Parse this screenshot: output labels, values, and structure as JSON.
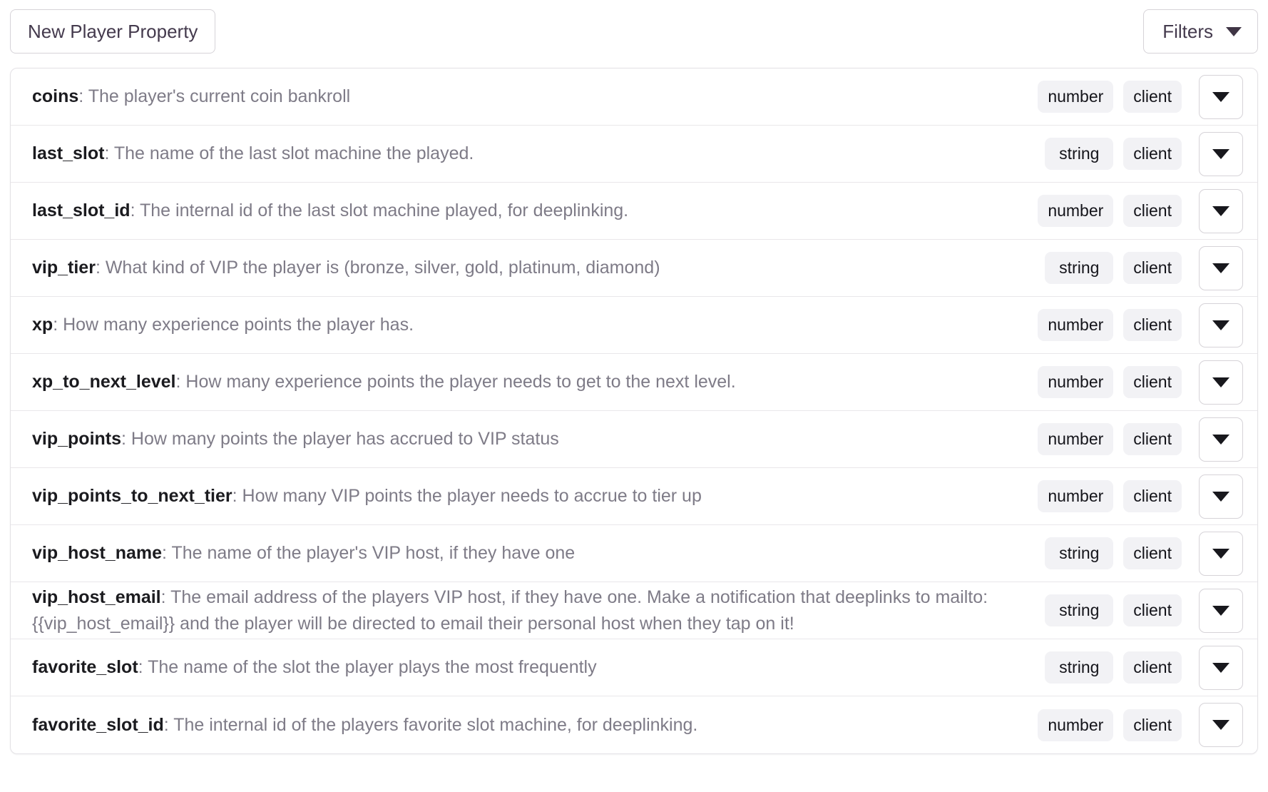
{
  "toolbar": {
    "new_property_label": "New Player Property",
    "filters_label": "Filters",
    "filters_caret_icon": "chevron-down-icon"
  },
  "colors": {
    "badge_background": "#f2f2f5",
    "badge_text": "#14141a",
    "description_text": "#7e7b87",
    "property_name_text": "#1b1b1f",
    "button_text": "#443a4d",
    "border": "#d6d3d8",
    "row_divider": "#e9e7ea"
  },
  "list": {
    "row_menu_icon": "chevron-down-icon",
    "rows": [
      {
        "name": "coins",
        "description": ": The player's current coin bankroll",
        "type": "number",
        "scope": "client"
      },
      {
        "name": "last_slot",
        "description": ": The name of the last slot machine the played.",
        "type": "string",
        "scope": "client"
      },
      {
        "name": "last_slot_id",
        "description": ": The internal id of the last slot machine played, for deeplinking.",
        "type": "number",
        "scope": "client"
      },
      {
        "name": "vip_tier",
        "description": ": What kind of VIP the player is (bronze, silver, gold, platinum, diamond)",
        "type": "string",
        "scope": "client"
      },
      {
        "name": "xp",
        "description": ": How many experience points the player has.",
        "type": "number",
        "scope": "client"
      },
      {
        "name": "xp_to_next_level",
        "description": ": How many experience points the player needs to get to the next level.",
        "type": "number",
        "scope": "client"
      },
      {
        "name": "vip_points",
        "description": ": How many points the player has accrued to VIP status",
        "type": "number",
        "scope": "client"
      },
      {
        "name": "vip_points_to_next_tier",
        "description": ": How many VIP points the player needs to accrue to tier up",
        "type": "number",
        "scope": "client"
      },
      {
        "name": "vip_host_name",
        "description": ": The name of the player's VIP host, if they have one",
        "type": "string",
        "scope": "client"
      },
      {
        "name": "vip_host_email",
        "description": ": The email address of the players VIP host, if they have one. Make a notification that deeplinks to mailto: {{vip_host_email}} and the player will be directed to email their personal host when they tap on it!",
        "type": "string",
        "scope": "client"
      },
      {
        "name": "favorite_slot",
        "description": ": The name of the slot the player plays the most frequently",
        "type": "string",
        "scope": "client"
      },
      {
        "name": "favorite_slot_id",
        "description": ": The internal id of the players favorite slot machine, for deeplinking.",
        "type": "number",
        "scope": "client"
      }
    ]
  }
}
